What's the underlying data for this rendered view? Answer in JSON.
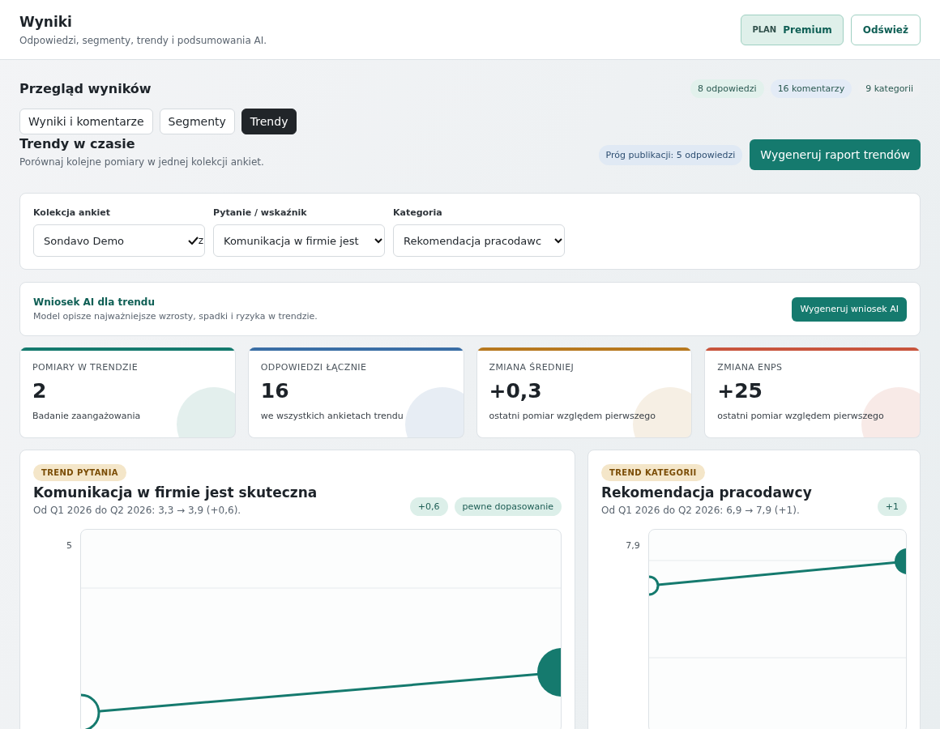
{
  "header": {
    "title": "Wyniki",
    "subtitle": "Odpowiedzi, segmenty, trendy i podsumowania AI.",
    "plan": {
      "label": "PLAN",
      "value": "Premium"
    },
    "refresh_button": "Odśwież"
  },
  "overview": {
    "title": "Przegląd wyników",
    "counts": [
      {
        "label": "8 odpowiedzi",
        "color": "#e2f1ec"
      },
      {
        "label": "16 komentarzy",
        "color": "#e3ebf6"
      },
      {
        "label": "9 kategorii",
        "color": "#eef0f2"
      }
    ],
    "tabs": [
      {
        "label": "Wyniki i komentarze",
        "selected": false
      },
      {
        "label": "Segmenty",
        "selected": false
      },
      {
        "label": "Trendy",
        "selected": true
      }
    ]
  },
  "section": {
    "title": "Trendy w czasie",
    "subtitle": "Porównaj kolejne pomiary w jednej kolekcji ankiet.",
    "threshold": "Próg publikacji: 5 odpowiedzi",
    "generate_button": "Wygeneruj raport trendów"
  },
  "filters": [
    {
      "label": "Kolekcja ankiet",
      "value": "Sondavo Demo",
      "overflow_text": "z"
    },
    {
      "label": "Pytanie / wskaźnik",
      "value": "Komunikacja w firmie jest"
    },
    {
      "label": "Kategoria",
      "value": "Rekomendacja pracodawc"
    }
  ],
  "ai_insight": {
    "title": "Wniosek AI dla trendu",
    "description": "Model opisze najważniejsze wzrosty, spadki i ryzyka w trendzie.",
    "button": "Wygeneruj wniosek AI"
  },
  "kpis": [
    {
      "label": "POMIARY W TRENDZIE",
      "value": "2",
      "note": "Badanie zaangażowania",
      "color": "#157a6e"
    },
    {
      "label": "ODPOWIEDZI ŁĄCZNIE",
      "value": "16",
      "note": "we wszystkich ankietach trendu",
      "color": "#3a6ea5"
    },
    {
      "label": "ZMIANA ŚREDNIEJ",
      "value": "+0,3",
      "note": "ostatni pomiar względem pierwszego",
      "color": "#b7791f"
    },
    {
      "label": "ZMIANA ENPS",
      "value": "+25",
      "note": "ostatni pomiar względem pierwszego",
      "color": "#c8553d"
    }
  ],
  "trend_cards": [
    {
      "tag": "TREND PYTANIA",
      "title": "Komunikacja w firmie jest skuteczna",
      "summary": "Od Q1 2026 do Q2 2026: 3,3 → 3,9 (+0,6).",
      "badges": [
        "+0,6",
        "pewne dopasowanie"
      ],
      "axis_label": "5"
    },
    {
      "tag": "TREND KATEGORII",
      "title": "Rekomendacja pracodawcy",
      "summary": "Od Q1 2026 do Q2 2026: 6,9 → 7,9 (+1).",
      "badges": [
        "+1"
      ],
      "axis_label": "7,9"
    }
  ]
}
